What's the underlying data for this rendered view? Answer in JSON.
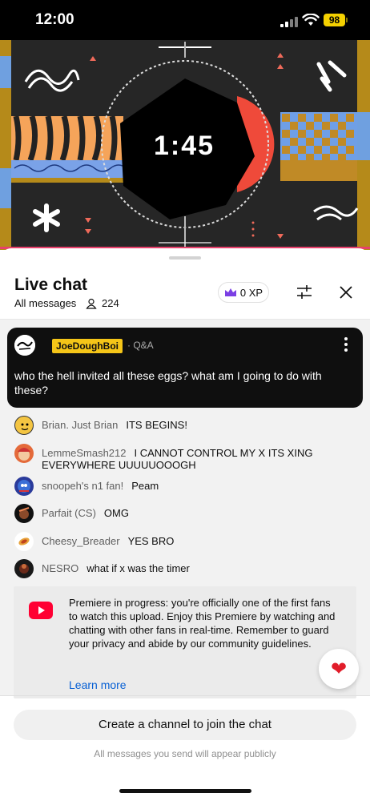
{
  "status_bar": {
    "time": "12:00",
    "battery": "98"
  },
  "video": {
    "timer": "1:45"
  },
  "chat": {
    "title": "Live chat",
    "filter": "All messages",
    "viewer_count": "224",
    "xp": "0 XP",
    "pinned": {
      "author": "JoeDoughBoi",
      "tag": "· Q&A",
      "text": "who the hell invited all these eggs? what am I going to do with these?"
    },
    "messages": [
      {
        "author": "Brian. Just Brian",
        "text": "ITS BEGINS!"
      },
      {
        "author": "LemmeSmash212",
        "text": "I CANNOT CONTROL MY X ITS XING EVERYWHERE UUUUUOOOGH"
      },
      {
        "author": "snoopeh's n1 fan!",
        "text": "Peam"
      },
      {
        "author": "Parfait (CS)",
        "text": "OMG"
      },
      {
        "author": "Cheesy_Breader",
        "text": "YES BRO"
      },
      {
        "author": "NESRO",
        "text": "what if x was the timer"
      }
    ],
    "notice": {
      "text": "Premiere in progress: you're officially one of the first fans to watch this upload. Enjoy this Premiere by watching and chatting with other fans in real-time. Remember to guard your privacy and abide by our community guidelines.",
      "link": "Learn more"
    },
    "join_button": "Create a channel to join the chat",
    "public_note": "All messages you send will appear publicly"
  },
  "colors": {
    "accent_red": "#ff0033",
    "link_blue": "#065fd4",
    "pinned_badge": "#f5c518",
    "battery": "#f5d100"
  },
  "icons": [
    "signal-icon",
    "wifi-icon",
    "battery-icon",
    "viewers-icon",
    "crown-icon",
    "tune-icon",
    "close-icon",
    "more-vert-icon",
    "youtube-icon",
    "heart-icon"
  ]
}
